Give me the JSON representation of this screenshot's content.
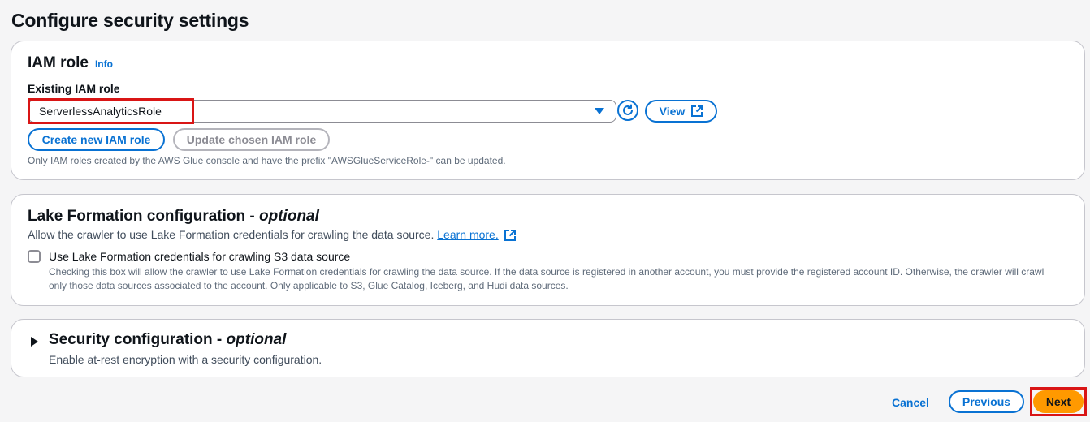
{
  "page": {
    "title": "Configure security settings"
  },
  "iam_role": {
    "heading": "IAM role",
    "info_label": "Info",
    "field_label": "Existing IAM role",
    "selected_value": "ServerlessAnalyticsRole",
    "refresh_icon": "refresh-icon",
    "view_label": "View",
    "create_label": "Create new IAM role",
    "update_label": "Update chosen IAM role",
    "hint": "Only IAM roles created by the AWS Glue console and have the prefix \"AWSGlueServiceRole-\" can be updated."
  },
  "lake_formation": {
    "heading": "Lake Formation configuration - ",
    "heading_optional": "optional",
    "description": "Allow the crawler to use Lake Formation credentials for crawling the data source.",
    "learn_more": "Learn more.",
    "checkbox_label": "Use Lake Formation credentials for crawling S3 data source",
    "checkbox_checked": false,
    "checkbox_description": "Checking this box will allow the crawler to use Lake Formation credentials for crawling the data source. If the data source is registered in another account, you must provide the registered account ID. Otherwise, the crawler will crawl only those data sources associated to the account. Only applicable to S3, Glue Catalog, Iceberg, and Hudi data sources."
  },
  "security_configuration": {
    "heading": "Security configuration - ",
    "heading_optional": "optional",
    "description": "Enable at-rest encryption with a security configuration.",
    "expanded": false
  },
  "footer": {
    "cancel_label": "Cancel",
    "previous_label": "Previous",
    "next_label": "Next"
  },
  "colors": {
    "accent": "#0972d3",
    "primary_button": "#ff9900",
    "highlight": "#d91515"
  }
}
